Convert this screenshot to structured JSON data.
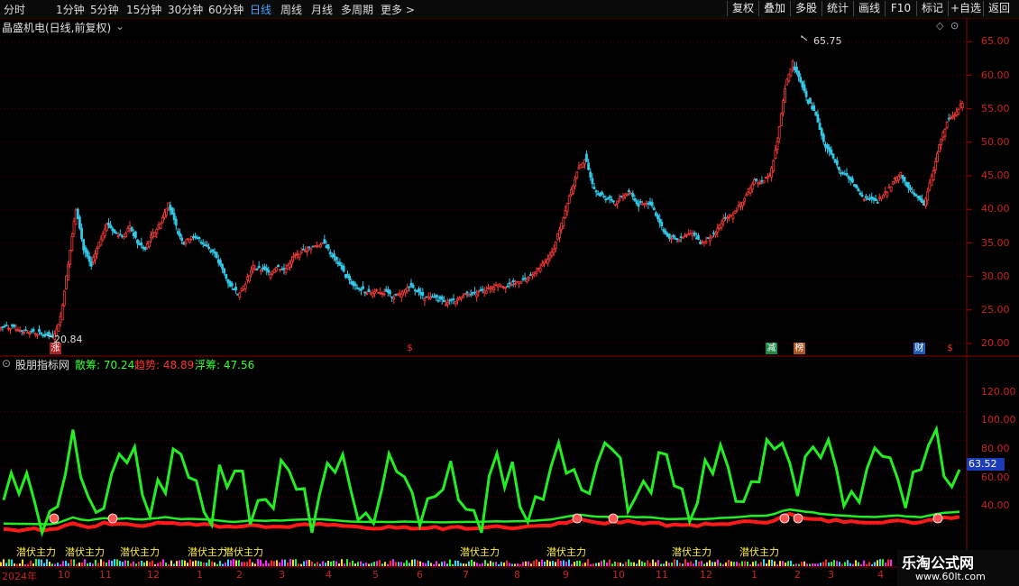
{
  "toolbar": {
    "periods": [
      "分时",
      "1分钟",
      "5分钟",
      "15分钟",
      "30分钟",
      "60分钟",
      "日线",
      "周线",
      "月线",
      "多周期",
      "更多 >"
    ],
    "active_period": "日线",
    "buttons": [
      "复权",
      "叠加",
      "多股",
      "统计",
      "画线",
      "F10",
      "标记",
      "+自选",
      "返回"
    ]
  },
  "main_chart": {
    "title": "晶盛机电(日线,前复权)",
    "y_axis": [
      "65.00",
      "60.00",
      "55.00",
      "50.00",
      "45.00",
      "40.00",
      "35.00",
      "30.00",
      "25.00",
      "20.00"
    ],
    "high_label": "65.75",
    "low_label": "20.84",
    "badges": [
      {
        "text": "涨",
        "color": "#cc2222"
      },
      {
        "text": "$",
        "color": "#ff3333"
      },
      {
        "text": "减",
        "color": "#22aa55"
      },
      {
        "text": "榜",
        "color": "#bb5522"
      },
      {
        "text": "财",
        "color": "#2266cc"
      },
      {
        "text": "$",
        "color": "#ff3333"
      }
    ]
  },
  "indicator": {
    "title": "股朋指标网",
    "values": [
      {
        "label": "散筹: 70.24",
        "color": "#33ff33"
      },
      {
        "label": "趋势: 48.89",
        "color": "#ff3333"
      },
      {
        "label": "浮筹: 47.56",
        "color": "#33ff33"
      }
    ],
    "y_axis": [
      "120.00",
      "100.00",
      "80.00",
      "60.00",
      "40.00"
    ],
    "current_value": "63.52",
    "signal_label": "潜伏主力"
  },
  "date_axis": [
    "2024年",
    "10",
    "11",
    "12",
    "1",
    "2",
    "3",
    "4",
    "5",
    "6",
    "7",
    "8",
    "9",
    "10",
    "11",
    "12",
    "1",
    "2",
    "3",
    "4"
  ],
  "watermark": {
    "name": "乐淘公式网",
    "url": "www.60lt.com"
  },
  "colors": {
    "up": "#ff3b3b",
    "down": "#33c8e8",
    "green_line": "#22ee22",
    "red_line": "#ff1a1a",
    "grid": "#5a0000"
  },
  "chart_data": {
    "type": "candlestick",
    "price_range": [
      20,
      65
    ],
    "close_series": [
      22.5,
      22.3,
      22.0,
      21.8,
      21.5,
      21.0,
      20.84,
      24.0,
      32.0,
      40.0,
      34.0,
      31.5,
      35.0,
      38.0,
      36.5,
      36.0,
      37.5,
      35.0,
      34.0,
      36.5,
      38.0,
      41.0,
      37.5,
      35.0,
      36.0,
      35.5,
      34.5,
      33.5,
      31.0,
      28.5,
      27.5,
      29.0,
      31.5,
      31.0,
      30.5,
      31.5,
      31.0,
      32.5,
      33.5,
      34.0,
      34.5,
      35.0,
      33.5,
      32.0,
      30.0,
      28.5,
      28.0,
      27.5,
      28.0,
      27.5,
      27.0,
      27.5,
      28.5,
      28.0,
      27.0,
      27.0,
      26.5,
      26.0,
      26.5,
      27.0,
      27.5,
      27.5,
      28.0,
      28.5,
      29.0,
      28.5,
      29.0,
      29.5,
      30.0,
      31.0,
      32.5,
      34.0,
      38.0,
      42.0,
      45.5,
      47.5,
      44.0,
      42.0,
      41.5,
      41.0,
      42.0,
      42.5,
      40.5,
      41.0,
      40.0,
      37.5,
      35.5,
      35.5,
      36.0,
      36.5,
      35.0,
      35.5,
      36.5,
      38.5,
      39.0,
      40.5,
      42.0,
      44.5,
      44.0,
      45.0,
      50.0,
      58.0,
      62.0,
      59.0,
      56.0,
      54.0,
      50.0,
      48.0,
      46.0,
      45.0,
      43.5,
      42.0,
      41.5,
      41.0,
      42.5,
      44.0,
      45.5,
      43.0,
      42.0,
      40.5,
      45.0,
      49.5,
      53.0,
      54.0,
      56.0
    ],
    "indicator_series": [
      {
        "name": "散筹",
        "last": 70.24
      },
      {
        "name": "趋势",
        "last": 48.89
      },
      {
        "name": "浮筹",
        "last": 47.56
      }
    ]
  }
}
